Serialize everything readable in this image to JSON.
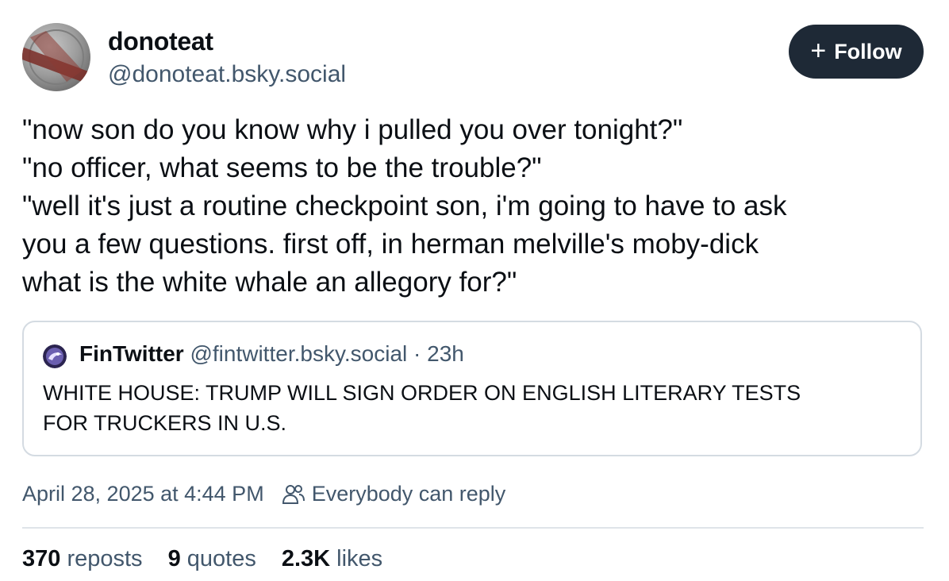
{
  "author": {
    "display_name": "donoteat",
    "handle": "@donoteat.bsky.social",
    "avatar_icon": "coin-avatar"
  },
  "follow_button": {
    "icon": "plus-icon",
    "icon_glyph": "+",
    "label": "Follow",
    "bg_color": "#1e2936"
  },
  "post": {
    "lines": [
      "\"now son do you know why i pulled you over tonight?\"",
      "\"no officer, what seems to be the trouble?\"",
      "\"well it's just a routine checkpoint son, i'm going to have to ask",
      "you a few questions. first off, in herman melville's moby-dick",
      "what is the white whale an allegory for?\""
    ]
  },
  "quote": {
    "display_name": "FinTwitter",
    "handle": "@fintwitter.bsky.social",
    "separator": "·",
    "time": "23h",
    "avatar_icon": "fintwitter-avatar",
    "lines": [
      "WHITE HOUSE: TRUMP WILL SIGN ORDER ON ENGLISH LITERARY TESTS",
      "FOR TRUCKERS IN U.S."
    ]
  },
  "meta": {
    "timestamp": "April 28, 2025 at 4:44 PM",
    "reply_icon": "people-icon",
    "reply_setting": "Everybody can reply"
  },
  "stats": {
    "reposts_count": "370",
    "reposts_label": "reposts",
    "quotes_count": "9",
    "quotes_label": "quotes",
    "likes_count": "2.3K",
    "likes_label": "likes"
  },
  "colors": {
    "text_primary": "#0b0f14",
    "text_secondary": "#42576c",
    "border": "#d4dbe2"
  }
}
